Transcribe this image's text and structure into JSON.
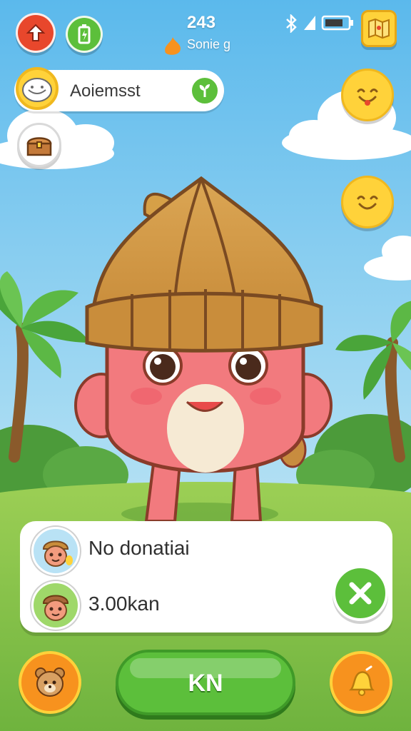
{
  "status_bar": {
    "level": "243",
    "score_label": "Sonie g"
  },
  "search": {
    "value": "Aoiemsst"
  },
  "profile_card": {
    "name": "No donatiai",
    "amount": "3.00kan"
  },
  "bottom_bar": {
    "main_button_label": "KN"
  },
  "icons": {
    "back": "up-arrow-icon",
    "battery_small": "battery-icon",
    "bluetooth": "bluetooth-icon",
    "signal": "signal-icon",
    "battery": "battery-status-icon",
    "map": "map-icon",
    "search_face": "face-icon",
    "search_go": "sprout-icon",
    "chest": "treasure-chest-icon",
    "emote": "smiley-icon",
    "close": "close-icon",
    "bear": "bear-icon",
    "bell": "bell-icon"
  },
  "colors": {
    "sky": "#6fc3ee",
    "grass": "#86c84a",
    "accent_green": "#5cbf3b",
    "accent_orange": "#f7921e",
    "accent_red": "#e8472c",
    "smiley": "#ffd23a"
  }
}
